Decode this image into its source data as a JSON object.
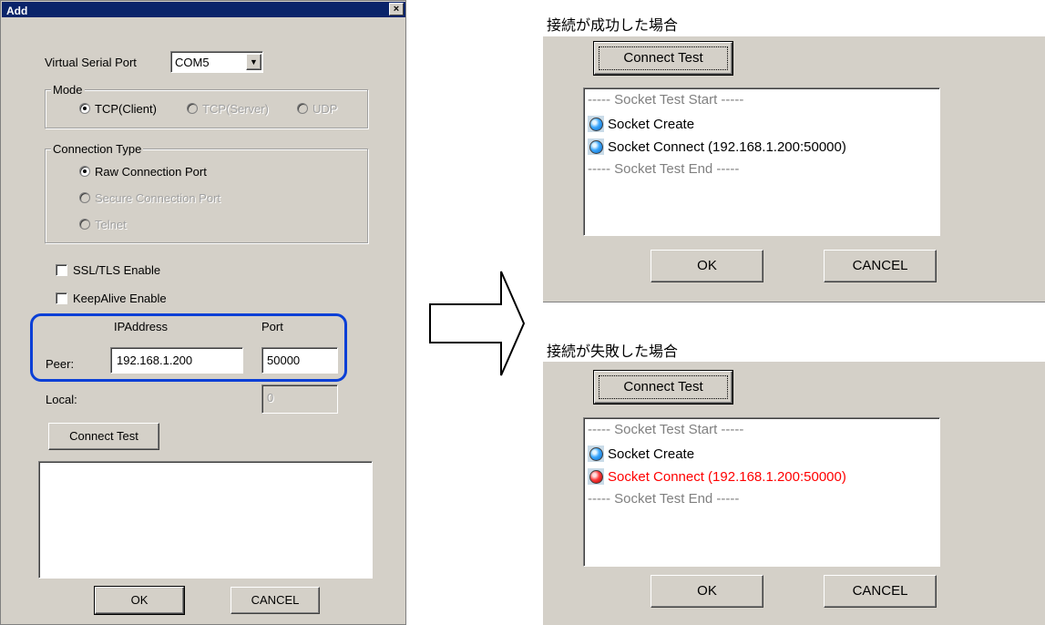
{
  "dialog": {
    "title": "Add",
    "close_glyph": "×",
    "virtual_serial_port": {
      "label": "Virtual Serial Port",
      "value": "COM5"
    },
    "mode": {
      "legend": "Mode",
      "options": [
        "TCP(Client)",
        "TCP(Server)",
        "UDP"
      ],
      "selected": "TCP(Client)"
    },
    "connection_type": {
      "legend": "Connection Type",
      "options": [
        "Raw Connection Port",
        "Secure Connection Port",
        "Telnet"
      ],
      "selected": "Raw Connection Port"
    },
    "ssl_tls": {
      "label": "SSL/TLS Enable",
      "checked": false
    },
    "keepalive": {
      "label": "KeepAlive Enable",
      "checked": false
    },
    "columns": {
      "ip": "IPAddress",
      "port": "Port"
    },
    "peer": {
      "label": "Peer:",
      "ip": "192.168.1.200",
      "port": "50000"
    },
    "local": {
      "label": "Local:",
      "port": "0"
    },
    "connect_test_label": "Connect Test",
    "ok_label": "OK",
    "cancel_label": "CANCEL",
    "highlight_color": "#0a3fd6"
  },
  "success_panel": {
    "heading": "接続が成功した場合",
    "connect_test_label": "Connect Test",
    "log": [
      {
        "text": "----- Socket Test Start -----",
        "kind": "dim"
      },
      {
        "text": "Socket Create",
        "kind": "ok",
        "led": "blue"
      },
      {
        "text": "Socket Connect (192.168.1.200:50000)",
        "kind": "ok",
        "led": "blue"
      },
      {
        "text": "----- Socket Test End -----",
        "kind": "dim"
      }
    ],
    "ok_label": "OK",
    "cancel_label": "CANCEL"
  },
  "failure_panel": {
    "heading": "接続が失敗した場合",
    "connect_test_label": "Connect Test",
    "log": [
      {
        "text": "----- Socket Test Start -----",
        "kind": "dim"
      },
      {
        "text": "Socket Create",
        "kind": "ok",
        "led": "blue"
      },
      {
        "text": "Socket Connect (192.168.1.200:50000)",
        "kind": "error",
        "led": "red"
      },
      {
        "text": "----- Socket Test End -----",
        "kind": "dim"
      }
    ],
    "ok_label": "OK",
    "cancel_label": "CANCEL",
    "error_color": "#ff0000"
  },
  "arrow": {
    "icon": "right-arrow-icon"
  }
}
